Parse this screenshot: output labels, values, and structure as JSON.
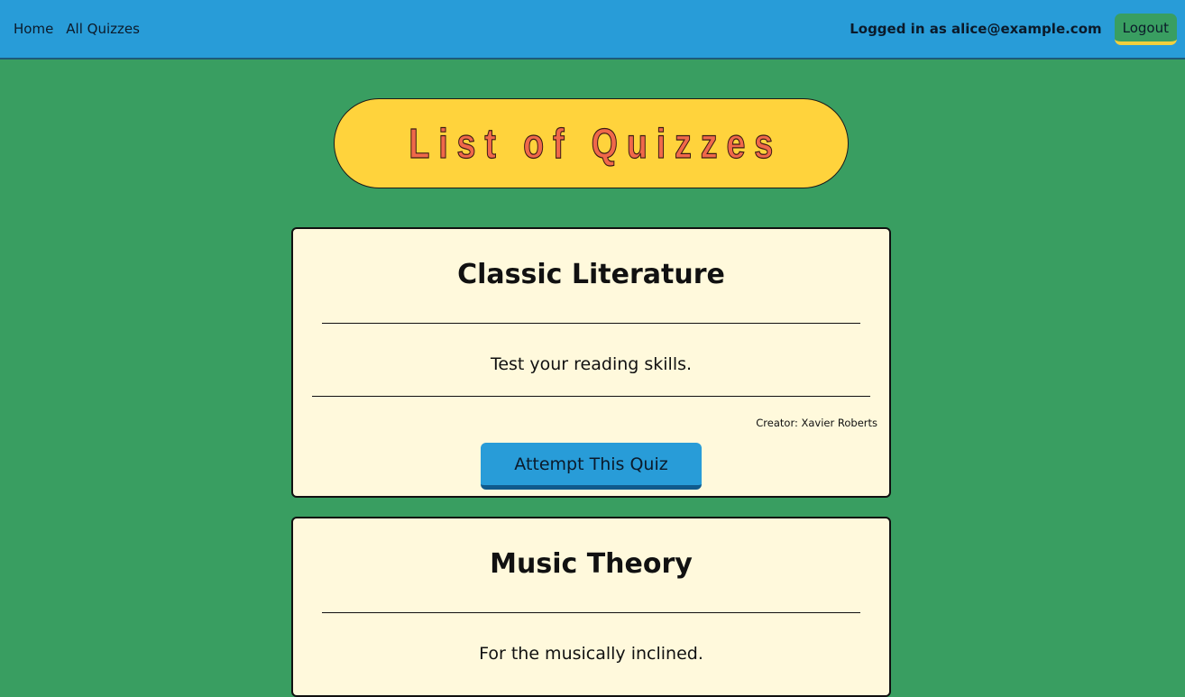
{
  "nav": {
    "home_label": "Home",
    "all_quizzes_label": "All Quizzes",
    "logged_in_text": "Logged in as alice@example.com",
    "logout_label": "Logout"
  },
  "page": {
    "title": "List of Quizzes"
  },
  "colors": {
    "topbar": "#289cd8",
    "background": "#399e61",
    "title_pill": "#ffd33c",
    "title_text": "#f0684a",
    "card": "#fff9dc",
    "button": "#289cd8",
    "logout_underline": "#f2cf3d"
  },
  "quizzes": [
    {
      "title": "Classic Literature",
      "description": "Test your reading skills.",
      "creator": "Creator: Xavier Roberts",
      "button_label": "Attempt This Quiz"
    },
    {
      "title": "Music Theory",
      "description": "For the musically inclined.",
      "creator": "",
      "button_label": ""
    }
  ]
}
